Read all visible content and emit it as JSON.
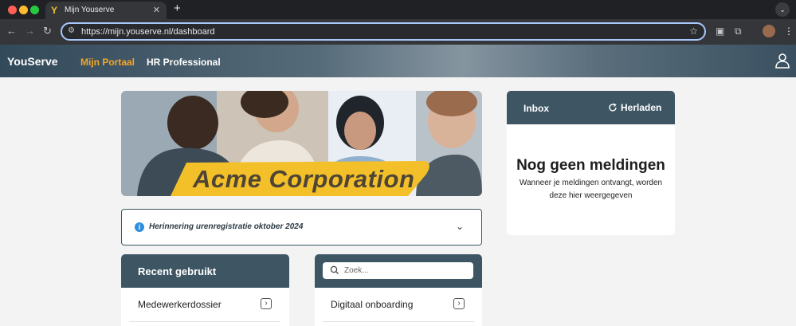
{
  "browser": {
    "tab_title": "Mijn Youserve",
    "new_tab": "+",
    "url": "https://mijn.youserve.nl/dashboard"
  },
  "header": {
    "logo": "YouServe",
    "nav": [
      "Mijn Portaal",
      "HR Professional"
    ],
    "accent_color": "#f5a623",
    "header_color": "#3e5664"
  },
  "banner": {
    "text": "Acme Corporation"
  },
  "reminder": {
    "text": "Herinnering urenregistratie oktober 2024"
  },
  "recent": {
    "title": "Recent gebruikt",
    "items": [
      "Medewerkerdossier"
    ]
  },
  "search": {
    "placeholder": "Zoek...",
    "items": [
      "Digitaal onboarding"
    ]
  },
  "inbox": {
    "title": "Inbox",
    "reload_label": "Herladen",
    "empty_title": "Nog geen meldingen",
    "empty_text": "Wanneer je meldingen ontvangt, worden deze hier weergegeven"
  }
}
